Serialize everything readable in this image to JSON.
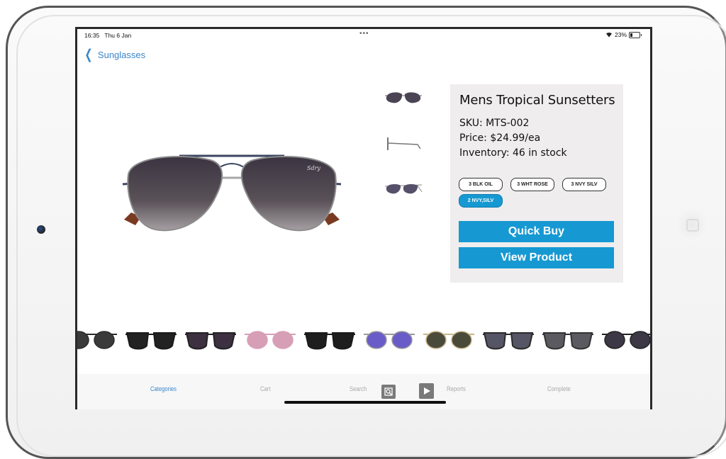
{
  "status_bar": {
    "time": "16:35",
    "date": "Thu 6 Jan",
    "multitask_dots": "•••",
    "battery_percent": "23%"
  },
  "nav": {
    "back_label": "Sunglasses"
  },
  "product": {
    "name": "Mens Tropical Sunsetters",
    "sku": "SKU: MTS-002",
    "price": "Price: $24.99/ea",
    "inventory": "Inventory: 46 in stock",
    "variants": [
      {
        "label": "3 BLK OIL",
        "selected": false
      },
      {
        "label": "3 WHT ROSE",
        "selected": false
      },
      {
        "label": "3 NVY SILV",
        "selected": false
      },
      {
        "label": "2 NVY,SILV",
        "selected": true
      }
    ],
    "quick_buy_label": "Quick Buy",
    "view_product_label": "View Product",
    "thumbnails": [
      "front-view",
      "side-view",
      "angle-view"
    ]
  },
  "carousel": {
    "items": [
      {
        "style": "round-dark",
        "lens": "#3a3a3a",
        "frame": "#2a2a2a"
      },
      {
        "style": "square-black",
        "lens": "#222222",
        "frame": "#1a1a1a"
      },
      {
        "style": "cat-eye-dark",
        "lens": "#3d3040",
        "frame": "#222222"
      },
      {
        "style": "round-pink",
        "lens": "#d79fb6",
        "frame": "#d79fb6"
      },
      {
        "style": "wayfarer-black",
        "lens": "#1e1e1e",
        "frame": "#1a1a1a"
      },
      {
        "style": "aviator-mirror",
        "lens": "#6a5cc8",
        "frame": "#999999"
      },
      {
        "style": "round-gold",
        "lens": "#4a4a3a",
        "frame": "#c9b58a"
      },
      {
        "style": "clubmaster-grey",
        "lens": "#555566",
        "frame": "#2a2a2a"
      },
      {
        "style": "square-grey",
        "lens": "#5a5a60",
        "frame": "#333333"
      },
      {
        "style": "round-navy",
        "lens": "#3d3845",
        "frame": "#222222"
      },
      {
        "style": "partial",
        "lens": "#333333",
        "frame": "#222222"
      }
    ]
  },
  "tabbar": {
    "tabs": [
      {
        "label": "Categories",
        "active": true
      },
      {
        "label": "Cart",
        "active": false
      },
      {
        "label": "Search",
        "active": false
      },
      {
        "label": "Reports",
        "active": false
      },
      {
        "label": "Complete",
        "active": false
      }
    ]
  },
  "colors": {
    "accent": "#1699d2",
    "link": "#3b87c8",
    "card_bg": "#efedee"
  }
}
